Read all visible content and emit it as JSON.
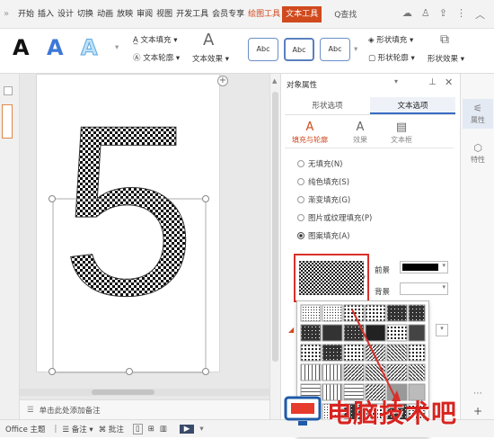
{
  "menubar": {
    "chevron": "»",
    "tabs": [
      "开始",
      "插入",
      "设计",
      "切换",
      "动画",
      "放映",
      "审阅",
      "视图",
      "开发工具",
      "会员专享",
      "绘图工具",
      "文本工具"
    ],
    "active_tab_index": 10,
    "selected_tab_index": 11,
    "search": "Q查找",
    "right_icons": [
      "cloud-icon",
      "user-icon",
      "share-icon",
      "more-icon",
      "collapse-icon"
    ]
  },
  "ribbon": {
    "styles": [
      "A",
      "A",
      "A"
    ],
    "text_fill": "文本填充",
    "text_outline": "文本轮廓",
    "text_effect": "文本效果",
    "abc": [
      "Abc",
      "Abc",
      "Abc"
    ],
    "shape_fill": "形状填充",
    "shape_outline": "形状轮廓",
    "shape_effect": "形状效果"
  },
  "slide": {
    "big_text": "5"
  },
  "notes": {
    "label": "单击此处添加备注"
  },
  "status": {
    "theme": "Office 主题",
    "notes_btn": "备注",
    "comments_btn": "批注"
  },
  "panel": {
    "title": "对象属性",
    "tabs": [
      "形状选项",
      "文本选项"
    ],
    "active_tab": 1,
    "subtabs": [
      "填充与轮廓",
      "效果",
      "文本框"
    ],
    "fill_options": [
      "无填充(N)",
      "纯色填充(S)",
      "渐变填充(G)",
      "图片或纹理填充(P)",
      "图案填充(A)"
    ],
    "selected_fill": 4,
    "foreground_label": "前景",
    "background_label": "背景"
  },
  "rightbar": {
    "prop": "属性",
    "style": "特性"
  },
  "watermark": {
    "text": "电脑技术吧"
  },
  "colors": {
    "accent": "#d04a1e",
    "tab_blue": "#3a6bc4",
    "watermark_red": "#d8231f"
  }
}
